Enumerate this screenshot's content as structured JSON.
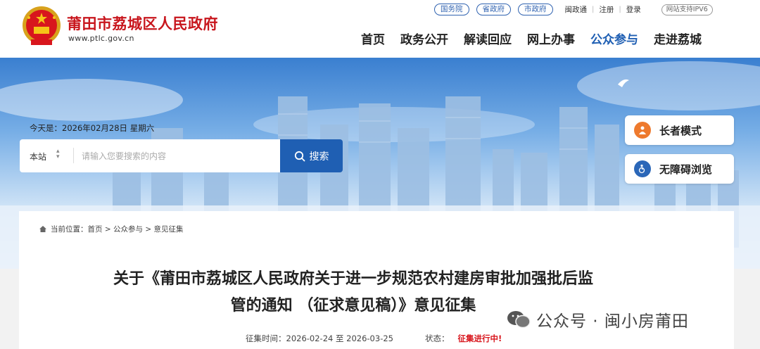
{
  "header": {
    "site_title": "莆田市荔城区人民政府",
    "site_url": "www.ptlc.gov.cn",
    "top_links": [
      "国务院",
      "省政府",
      "市政府"
    ],
    "top_text": [
      "闽政通",
      "注册",
      "登录"
    ],
    "ipv6": "网站支持IPV6",
    "nav": [
      "首页",
      "政务公开",
      "解读回应",
      "网上办事",
      "公众参与",
      "走进荔城"
    ],
    "active_nav": "公众参与"
  },
  "banner": {
    "date": "今天是：2026年02月28日 星期六",
    "search_scope": "本站",
    "search_placeholder": "请输入您要搜索的内容",
    "search_button": "搜索",
    "elder_mode": "长者模式",
    "accessible": "无障碍浏览"
  },
  "breadcrumb": {
    "prefix": "当前位置：",
    "items": [
      "首页",
      "公众参与",
      "意见征集"
    ]
  },
  "article": {
    "title_line1": "关于《莆田市荔城区人民政府关于进一步规范农村建房审批加强批后监",
    "title_line2": "管的通知 （征求意见稿）》意见征集",
    "period_label": "征集时间：",
    "period_value": "2026-02-24 至 2026-03-25",
    "status_label": "状态：",
    "status_value": "征集进行中!"
  },
  "watermark": "公众号 · 闽小房莆田",
  "colors": {
    "brand_red": "#c8161d",
    "brand_blue": "#1f5fb3",
    "status_red": "#d8161d"
  }
}
